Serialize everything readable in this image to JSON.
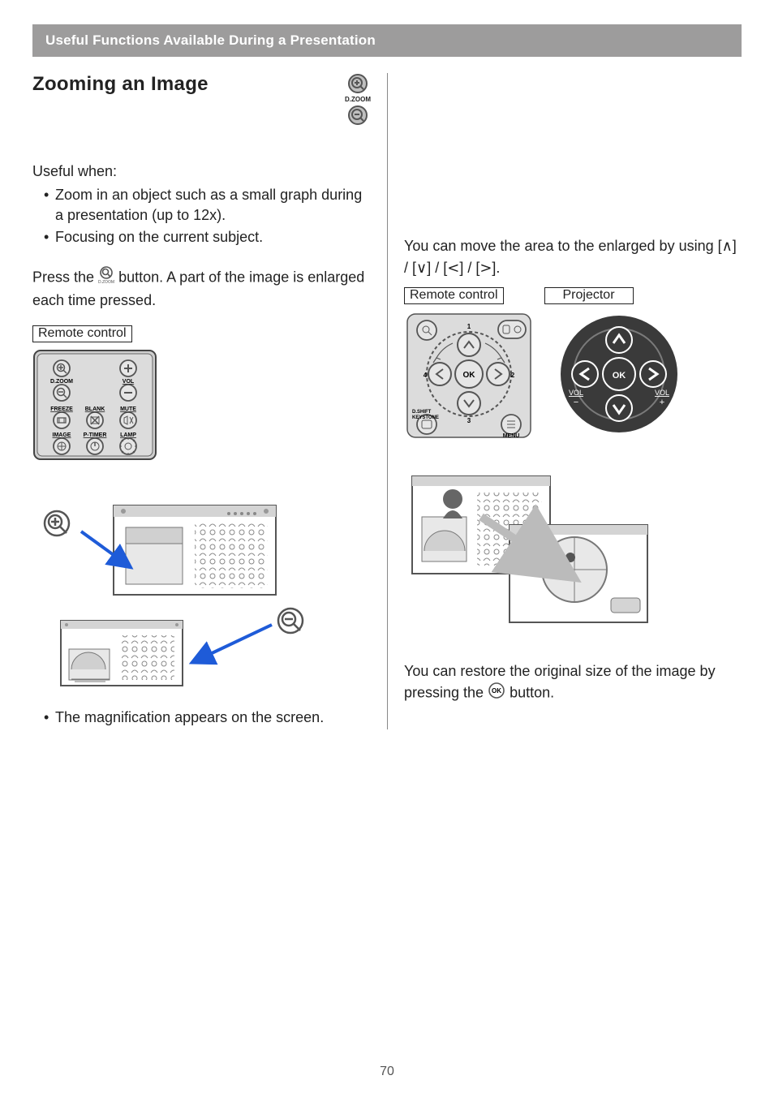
{
  "header": {
    "breadcrumb": "Useful Functions Available During a Presentation"
  },
  "left": {
    "title": "Zooming an Image",
    "dzoom_label": "D.ZOOM",
    "useful_when_heading": "Useful when:",
    "bullets": [
      "Zoom in an object such as a small graph during a presentation (up to 12x).",
      "Focusing on the current subject."
    ],
    "press_pre": "Press the ",
    "press_post": " button. A part of the image is enlarged each time pressed.",
    "remote_label": "Remote control",
    "remote_btn_labels": {
      "dzoom": "D.ZOOM",
      "vol": "VOL",
      "freeze": "FREEZE",
      "blank": "BLANK",
      "mute": "MUTE",
      "image": "IMAGE",
      "ptimer": "P-TIMER",
      "lamp": "LAMP"
    },
    "mag_note": "The magnification appears on the screen."
  },
  "right": {
    "move_text_pre": "You can move the area to the enlarged by using [",
    "sep_a": "] / [",
    "sep_b": "] / [",
    "sep_c": "] / [",
    "move_text_post": "].",
    "remote_label": "Remote control",
    "projector_label": "Projector",
    "nav_labels": {
      "ok": "OK",
      "n1": "1",
      "n2": "2",
      "n3": "3",
      "n4": "4",
      "dshift": "D.SHIFT",
      "keystone": "KEYSTONE",
      "menu": "MENU",
      "vol_minus": "VOL",
      "minus": "−",
      "vol_plus": "VOL",
      "plus": "+"
    },
    "restore_pre": "You can restore the original size of the image by pressing the ",
    "restore_post": " button."
  },
  "page_number": "70"
}
